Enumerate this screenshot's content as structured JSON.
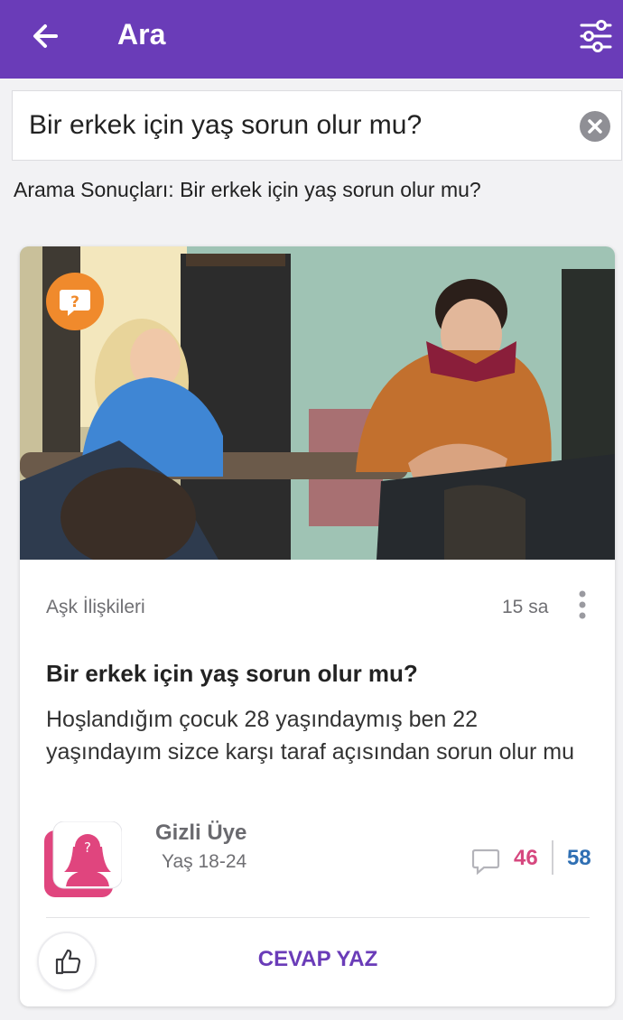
{
  "header": {
    "title": "Ara",
    "back_icon": "arrow-left-icon",
    "filter_icon": "sliders-icon",
    "background": "#6a3cb8"
  },
  "search": {
    "value": "Bir erkek için yaş sorun olur mu?",
    "clear_icon": "close-circle-icon"
  },
  "results_label": "Arama Sonuçları: Bir erkek için yaş sorun olur mu?",
  "card": {
    "badge_icon": "question-bubble-icon",
    "category": "Aşk İlişkileri",
    "time": "15 sa",
    "title": "Bir erkek için yaş sorun olur mu?",
    "body": "Hoşlandığım çocuk 28 yaşındaymış ben 22 yaşındayım sizce karşı taraf açısından sorun olur mu",
    "author": {
      "name": "Gizli Üye",
      "age": "Yaş 18-24",
      "avatar_icon": "anonymous-female-avatar-icon"
    },
    "stats": {
      "answers": "46",
      "answers_color": "#d6487f",
      "views": "58",
      "views_color": "#2f6fb3"
    },
    "actions": {
      "like_icon": "thumbs-up-icon",
      "answer_label": "CEVAP YAZ"
    }
  }
}
